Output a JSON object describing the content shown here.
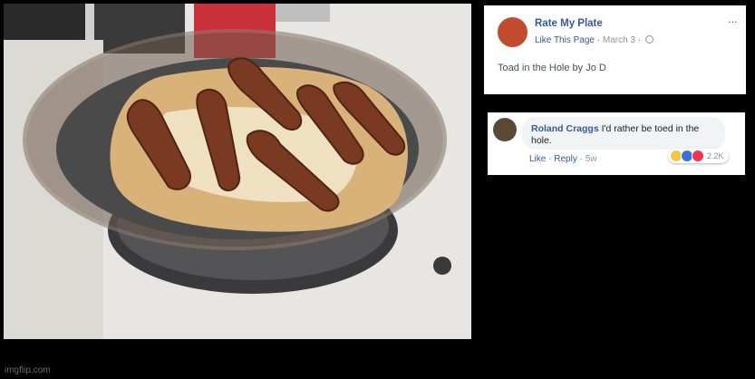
{
  "post": {
    "page_name": "Rate My Plate",
    "like_link": "Like This Page",
    "date": "March 3",
    "text": "Toad in the Hole by Jo D",
    "more": "···"
  },
  "comment": {
    "name": "Roland Craggs",
    "text": "I'd rather be toed in the hole.",
    "like": "Like",
    "reply": "Reply",
    "age": "5w",
    "reaction_count": "2.2K"
  },
  "watermark": "imgflip.com",
  "colors": {
    "link": "#385898",
    "background": "#000000"
  }
}
